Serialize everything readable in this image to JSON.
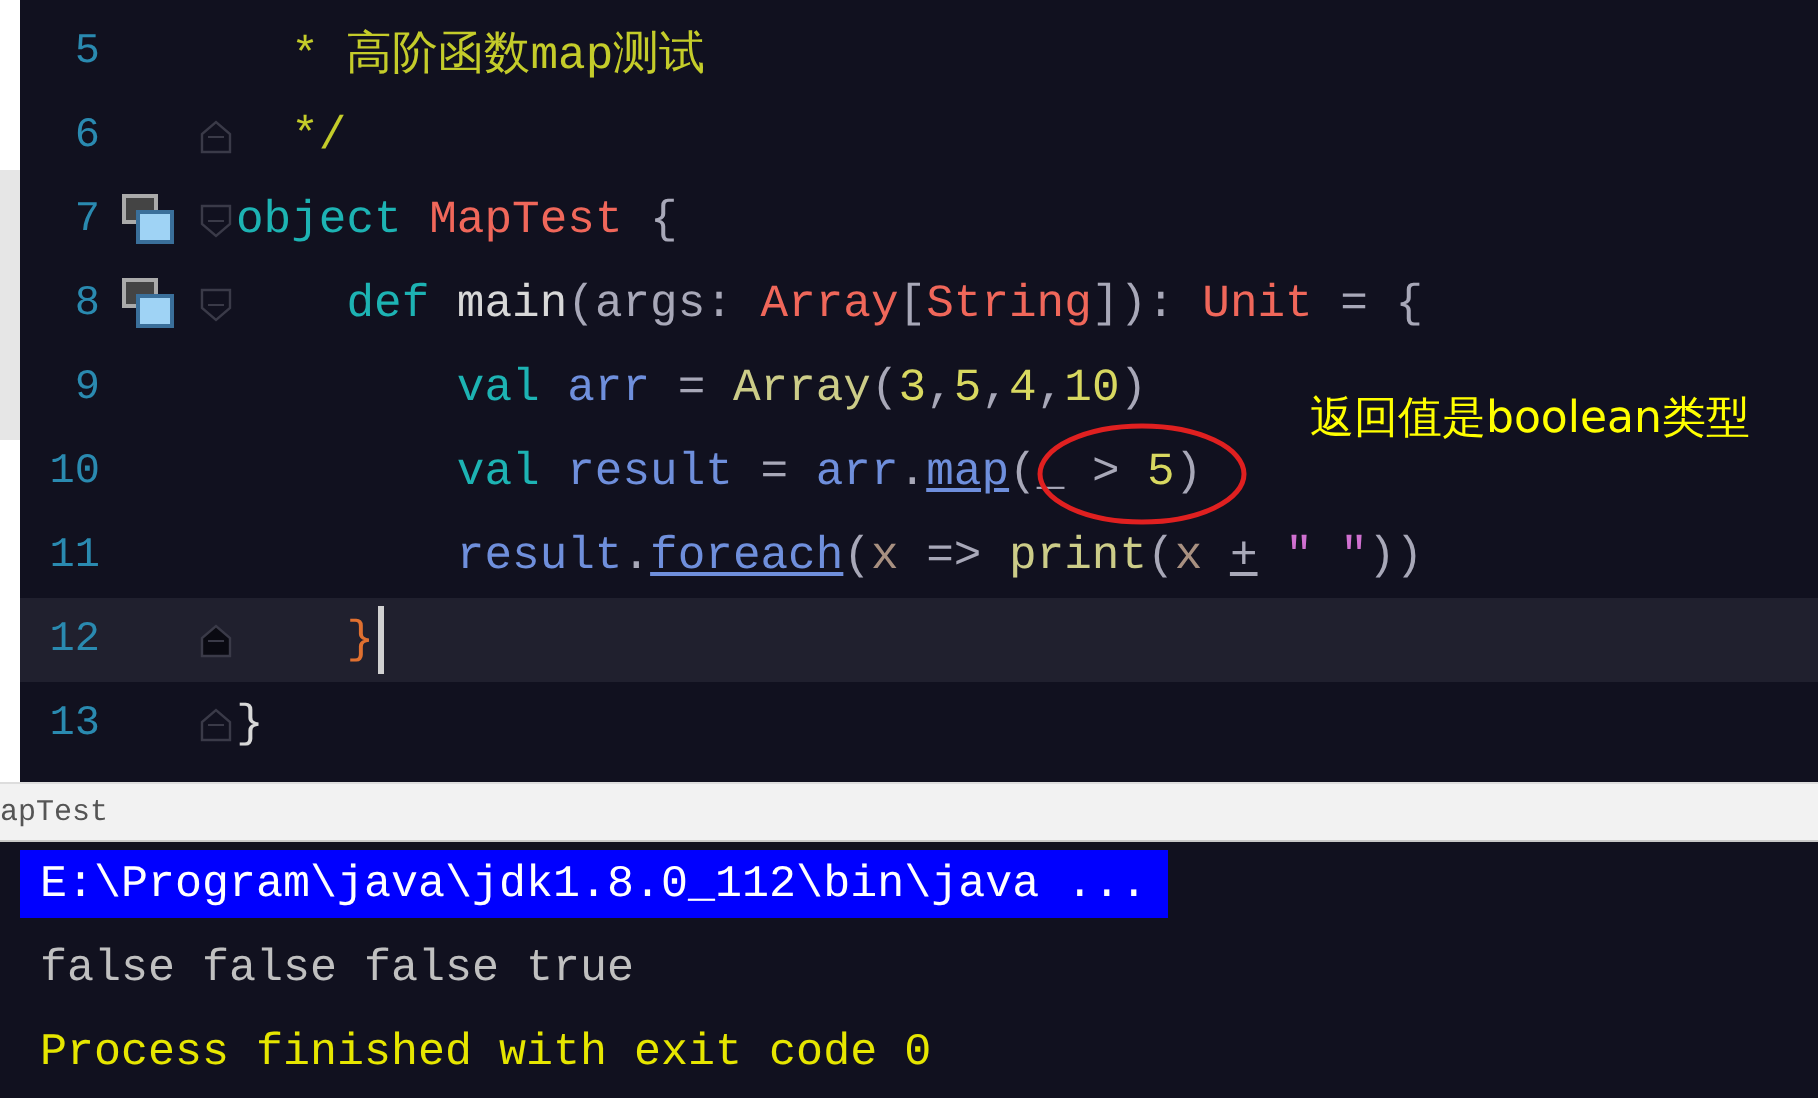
{
  "editor": {
    "lines": [
      {
        "number": "5",
        "current": false,
        "run_icon": false,
        "tokens": [
          {
            "text": "  * 高阶函数map测试",
            "kind": "comment"
          }
        ]
      },
      {
        "number": "6",
        "current": false,
        "run_icon": false,
        "fold_marker": {
          "kind": "end"
        },
        "tokens": [
          {
            "text": "  */",
            "kind": "comment"
          }
        ]
      },
      {
        "number": "7",
        "current": false,
        "run_icon": true,
        "fold_marker": {
          "kind": "start"
        },
        "tokens": [
          {
            "text": "object",
            "kind": "keyword"
          },
          {
            "text": " MapTest",
            "kind": "type"
          },
          {
            "text": " {",
            "kind": "punct"
          }
        ]
      },
      {
        "number": "8",
        "current": false,
        "run_icon": true,
        "fold_marker": {
          "kind": "start"
        },
        "tokens": [
          {
            "text": "    def",
            "kind": "keyword"
          },
          {
            "text": " main",
            "kind": "plain"
          },
          {
            "text": "(args: ",
            "kind": "punct"
          },
          {
            "text": "Array",
            "kind": "type"
          },
          {
            "text": "[",
            "kind": "punct"
          },
          {
            "text": "String",
            "kind": "type"
          },
          {
            "text": "]): ",
            "kind": "punct"
          },
          {
            "text": "Unit",
            "kind": "type"
          },
          {
            "text": " = {",
            "kind": "punct"
          }
        ]
      },
      {
        "number": "9",
        "current": false,
        "run_icon": false,
        "tokens": [
          {
            "text": "        val",
            "kind": "keyword"
          },
          {
            "text": " arr",
            "kind": "ident"
          },
          {
            "text": " = ",
            "kind": "punct"
          },
          {
            "text": "Array",
            "kind": "call"
          },
          {
            "text": "(",
            "kind": "punct"
          },
          {
            "text": "3",
            "kind": "number"
          },
          {
            "text": ",",
            "kind": "punct"
          },
          {
            "text": "5",
            "kind": "number"
          },
          {
            "text": ",",
            "kind": "punct"
          },
          {
            "text": "4",
            "kind": "number"
          },
          {
            "text": ",",
            "kind": "punct"
          },
          {
            "text": "10",
            "kind": "number"
          },
          {
            "text": ")",
            "kind": "punct"
          }
        ]
      },
      {
        "number": "10",
        "current": false,
        "run_icon": false,
        "tokens": [
          {
            "text": "        val",
            "kind": "keyword"
          },
          {
            "text": " result",
            "kind": "ident"
          },
          {
            "text": " = ",
            "kind": "punct"
          },
          {
            "text": "arr",
            "kind": "ident"
          },
          {
            "text": ".",
            "kind": "punct"
          },
          {
            "text": "map",
            "kind": "link"
          },
          {
            "text": "(_ > ",
            "kind": "punct"
          },
          {
            "text": "5",
            "kind": "number"
          },
          {
            "text": ")",
            "kind": "punct"
          }
        ]
      },
      {
        "number": "11",
        "current": false,
        "run_icon": false,
        "tokens": [
          {
            "text": "        result",
            "kind": "ident"
          },
          {
            "text": ".",
            "kind": "punct"
          },
          {
            "text": "foreach",
            "kind": "link"
          },
          {
            "text": "(",
            "kind": "punct"
          },
          {
            "text": "x",
            "kind": "param"
          },
          {
            "text": " => ",
            "kind": "punct"
          },
          {
            "text": "print",
            "kind": "call"
          },
          {
            "text": "(",
            "kind": "punct"
          },
          {
            "text": "x ",
            "kind": "param"
          },
          {
            "text": "+",
            "kind": "oplink"
          },
          {
            "text": " \" \"",
            "kind": "string"
          },
          {
            "text": "))",
            "kind": "punct"
          }
        ]
      },
      {
        "number": "12",
        "current": true,
        "run_icon": false,
        "fold_marker": {
          "kind": "end"
        },
        "tokens": [
          {
            "text": "    }",
            "kind": "brace"
          }
        ]
      },
      {
        "number": "13",
        "current": false,
        "run_icon": false,
        "fold_marker": {
          "kind": "end"
        },
        "tokens": [
          {
            "text": "}",
            "kind": "plain"
          }
        ]
      }
    ]
  },
  "annotation": {
    "text": "返回值是boolean类型"
  },
  "console": {
    "tab": "apTest",
    "lines": [
      {
        "text": "E:\\Program\\java\\jdk1.8.0_112\\bin\\java ...",
        "kind": "command",
        "selected": true
      },
      {
        "text": "false false false true",
        "kind": "output",
        "selected": false
      },
      {
        "text": "Process finished with exit code 0",
        "kind": "status",
        "selected": false
      }
    ]
  }
}
